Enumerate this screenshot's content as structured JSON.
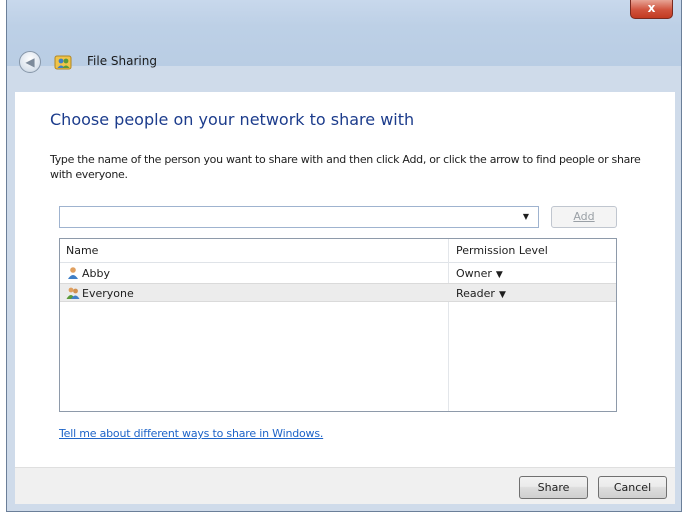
{
  "window": {
    "title": "File Sharing",
    "close_glyph": "x"
  },
  "main": {
    "heading": "Choose people on your network to share with",
    "instructions": "Type the name of the person you want to share with and then click Add, or click the arrow to find people or share with everyone.",
    "name_input": {
      "value": "",
      "placeholder": ""
    },
    "add_label": "Add",
    "columns": {
      "name": "Name",
      "permission": "Permission Level"
    },
    "rows": [
      {
        "name": "Abby",
        "permission": "Owner",
        "icon": "user-icon"
      },
      {
        "name": "Everyone",
        "permission": "Reader",
        "icon": "group-icon"
      }
    ],
    "help_link": "Tell me about different ways to share in Windows."
  },
  "footer": {
    "share_label": "Share",
    "cancel_label": "Cancel"
  },
  "colors": {
    "heading": "#1c3c8c",
    "link": "#1e64c8",
    "close_button": "#c8452c",
    "frame": "#cfdbea"
  }
}
